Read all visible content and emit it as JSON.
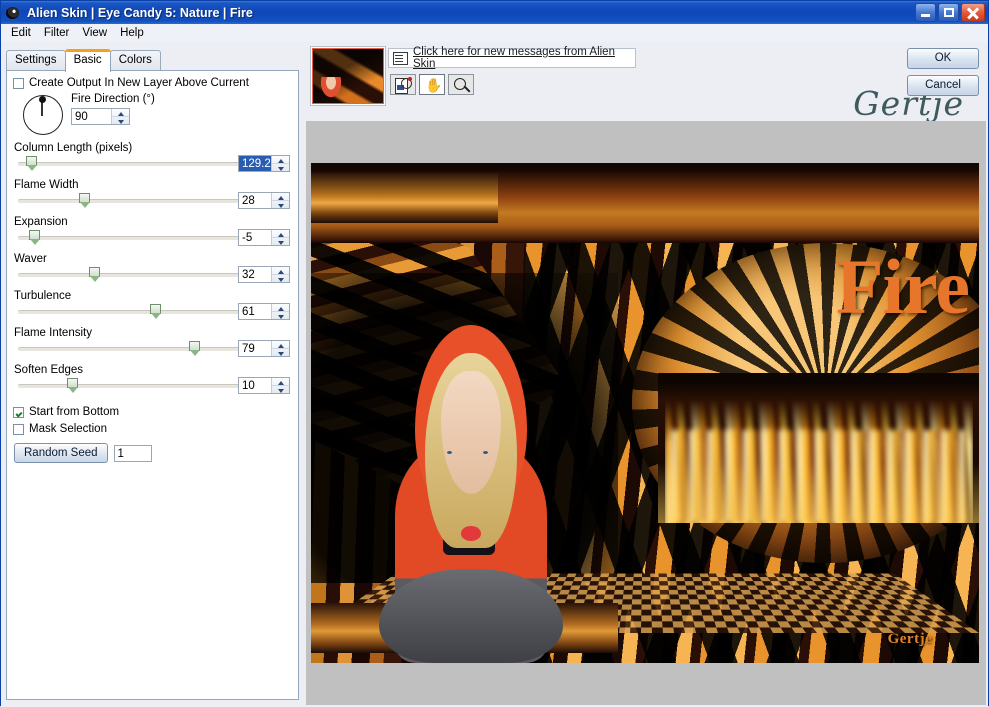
{
  "window": {
    "title": "Alien Skin | Eye Candy 5: Nature | Fire",
    "icon": "alien-eye-icon",
    "buttons": {
      "minimize": "minimize-icon",
      "maximize": "maximize-icon",
      "close": "close-icon"
    }
  },
  "menubar": {
    "items": [
      "Edit",
      "Filter",
      "View",
      "Help"
    ]
  },
  "tabs": [
    {
      "label": "Settings",
      "active": false
    },
    {
      "label": "Basic",
      "active": true
    },
    {
      "label": "Colors",
      "active": false
    }
  ],
  "panel": {
    "create_output_checkbox": {
      "label": "Create Output In New Layer Above Current",
      "checked": false
    },
    "fire_direction": {
      "label": "Fire Direction (°)",
      "value": "90",
      "dial_angle_deg": 90
    },
    "sliders": [
      {
        "label": "Column Length (pixels)",
        "value": "129.25",
        "selected": true,
        "thumb_pct": 10
      },
      {
        "label": "Flame Width",
        "value": "28",
        "selected": false,
        "thumb_pct": 28
      },
      {
        "label": "Expansion",
        "value": "-5",
        "selected": false,
        "thumb_pct": 7
      },
      {
        "label": "Waver",
        "value": "32",
        "selected": false,
        "thumb_pct": 32
      },
      {
        "label": "Turbulence",
        "value": "61",
        "selected": false,
        "thumb_pct": 61
      },
      {
        "label": "Flame Intensity",
        "value": "79",
        "selected": false,
        "thumb_pct": 79
      },
      {
        "label": "Soften Edges",
        "value": "10",
        "selected": false,
        "thumb_pct": 21
      }
    ],
    "start_from_bottom": {
      "label": "Start from Bottom",
      "checked": true
    },
    "mask_selection": {
      "label": "Mask Selection",
      "checked": false
    },
    "random_seed": {
      "button_label": "Random Seed",
      "value": "1"
    }
  },
  "preview_header": {
    "thumbnail": "preview-thumbnail",
    "message_link": "Click here for new messages from Alien Skin",
    "message_icon": "envelope-icon",
    "tools": [
      {
        "name": "preview-compare-icon",
        "active": false
      },
      {
        "name": "pan-hand-icon",
        "active": true
      },
      {
        "name": "zoom-magnifier-icon",
        "active": false
      }
    ],
    "signature": "Gertje"
  },
  "actions": {
    "ok_label": "OK",
    "cancel_label": "Cancel"
  },
  "artwork": {
    "title_text": "Fire",
    "signature": "Gertje",
    "title_color": "#e8762a",
    "signature_color": "#e08226"
  },
  "colors": {
    "titlebar_blue": "#0f47b8",
    "accent_orange": "#f7a01a",
    "panel_bg": "#eceef3",
    "preview_bg": "#c0c0c0",
    "selection_blue": "#2a5db0"
  }
}
